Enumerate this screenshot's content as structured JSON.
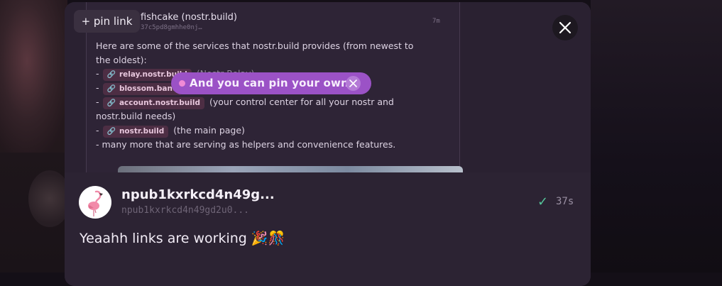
{
  "quoted_note": {
    "author": "fishcake (nostr.build)",
    "pubkey": "37c5pd8gmhhe0nj…",
    "time": "7m",
    "intro": "Here are some of the services that nostr.build provides (from newest to the oldest):",
    "items": [
      {
        "prefix": "- ",
        "link": "relay.nostr.build",
        "desc": "(Nostr Relay)"
      },
      {
        "prefix": "- ",
        "link": "blossom.band",
        "desc": ""
      },
      {
        "prefix": "- ",
        "link": "account.nostr.build",
        "desc": "(your control center for all your nostr and nostr.build needs)"
      },
      {
        "prefix": "- ",
        "link": "nostr.build",
        "desc": "(the main page)"
      }
    ],
    "outro": "- many more that are serving as helpers and convenience features."
  },
  "pin_link_label": "+ pin link",
  "pin_tooltip": {
    "text": "And you can pin your own"
  },
  "note": {
    "display_name": "npub1kxrkcd4n49g...",
    "npub": "npub1kxrkcd4n49gd2u0...",
    "time": "37s",
    "content": "Yeaahh links are working 🎉🎊"
  },
  "icons": {
    "link": "link-icon",
    "close": "close-icon",
    "verified": "check-icon",
    "avatar": "flamingo-avatar"
  },
  "colors": {
    "accent_purple": "#9b52c6",
    "link_chip": "#4d2e44",
    "verified_green": "#55c59a",
    "modal_bg": "#2c2333"
  }
}
